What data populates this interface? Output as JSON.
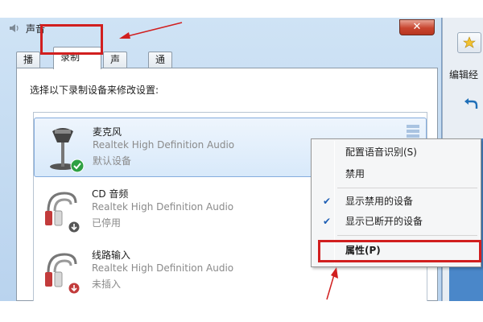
{
  "dialog": {
    "title": "声音",
    "close_glyph": "✕",
    "tabs": [
      {
        "label": "播放",
        "active": false
      },
      {
        "label": "录制",
        "active": true
      },
      {
        "label": "声音",
        "active": false
      },
      {
        "label": "通信",
        "active": false
      }
    ],
    "instruction": "选择以下录制设备来修改设置:",
    "devices": [
      {
        "name": "麦克风",
        "driver": "Realtek High Definition Audio",
        "status": "默认设备",
        "icon": "microphone-icon",
        "badge": "default-check-icon",
        "selected": true
      },
      {
        "name": "CD 音频",
        "driver": "Realtek High Definition Audio",
        "status": "已停用",
        "icon": "audio-cable-icon",
        "badge": "disabled-arrow-icon",
        "selected": false
      },
      {
        "name": "线路输入",
        "driver": "Realtek High Definition Audio",
        "status": "未插入",
        "icon": "audio-cable-icon",
        "badge": "unplugged-icon",
        "selected": false
      }
    ]
  },
  "context_menu": {
    "items": [
      {
        "label": "配置语音识别(S)",
        "checked": false
      },
      {
        "label": "禁用",
        "checked": false
      },
      {
        "label": "显示禁用的设备",
        "checked": true
      },
      {
        "label": "显示已断开的设备",
        "checked": true
      },
      {
        "label": "属性(P)",
        "checked": false,
        "highlighted": true
      }
    ],
    "check_glyph": "✔"
  },
  "background_window": {
    "text": "编辑经"
  },
  "colors": {
    "annotation_red": "#d11f1f",
    "selection_blue": "#84acdd",
    "check_blue": "#1f5fb4"
  }
}
